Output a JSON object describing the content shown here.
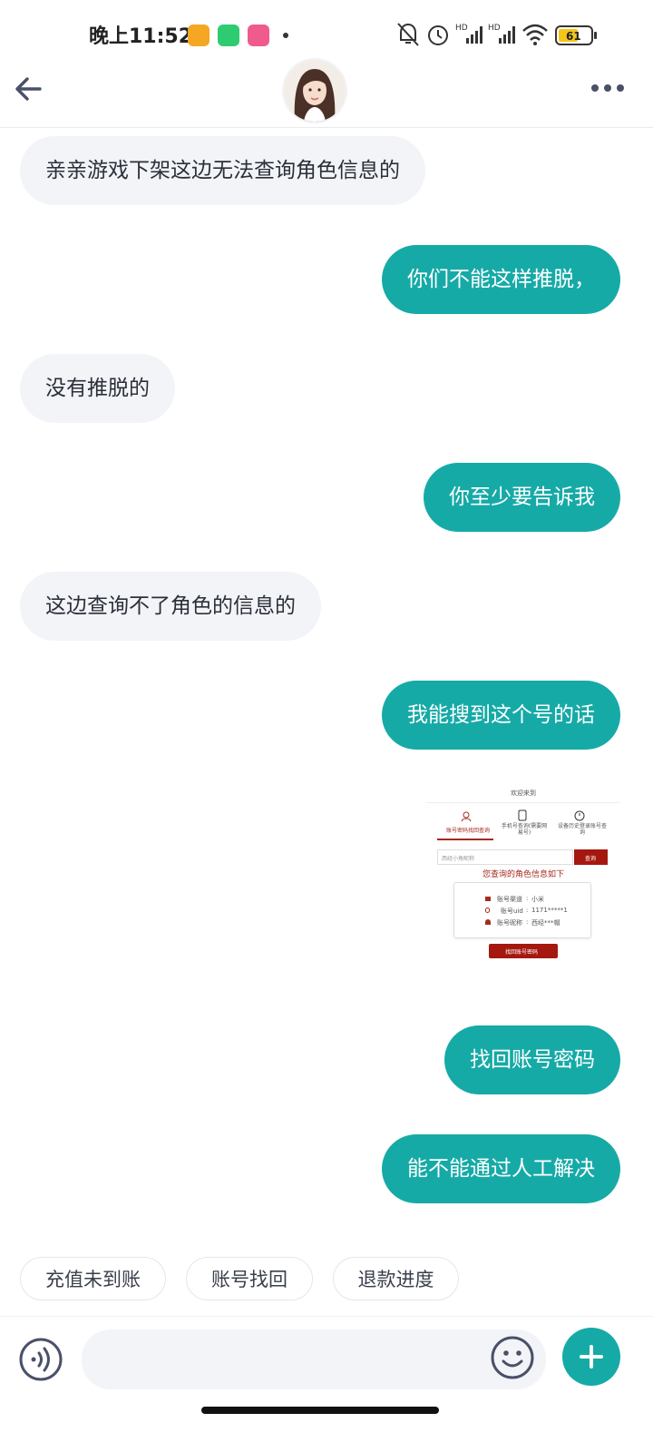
{
  "status_bar": {
    "time": "晚上11:52",
    "battery": "61",
    "network_labels": [
      "HD",
      "HD"
    ]
  },
  "header": {
    "back_icon": "arrow-left-icon",
    "avatar": "agent-avatar",
    "more_icon": "more-dots-icon"
  },
  "messages": [
    {
      "side": "left",
      "text": "亲亲游戏下架这边无法查询角色信息的"
    },
    {
      "side": "right",
      "text": "你们不能这样推脱，"
    },
    {
      "side": "left",
      "text": "没有推脱的"
    },
    {
      "side": "right",
      "text": "你至少要告诉我"
    },
    {
      "side": "left",
      "text": "这边查询不了角色的信息的"
    },
    {
      "side": "right",
      "text": "我能搜到这个号的话"
    },
    {
      "side": "right",
      "text": "找回账号密码"
    },
    {
      "side": "right",
      "text": "能不能通过人工解决"
    }
  ],
  "shared_image": {
    "title": "欢迎来到",
    "tabs": [
      "账号密码找回查询",
      "手机号查询(需要网易号)",
      "设备历史登录账号查询"
    ],
    "input_placeholder": "西经小角昵称",
    "query_button": "查询",
    "result_title": "您查询的角色信息如下",
    "rows": [
      {
        "label": "账号渠道",
        "value": "小米"
      },
      {
        "label": "账号uid",
        "value": "1171*****1"
      },
      {
        "label": "账号昵称",
        "value": "西经***帽"
      }
    ],
    "recover_button": "找回账号密码"
  },
  "quick_replies": [
    "充值未到账",
    "账号找回",
    "退款进度"
  ],
  "input": {
    "placeholder": "",
    "voice_icon": "voice-icon",
    "emoji_icon": "emoji-icon",
    "plus_icon": "plus-icon"
  },
  "colors": {
    "accent": "#16aaa7",
    "left_bubble": "#f2f4f7"
  }
}
